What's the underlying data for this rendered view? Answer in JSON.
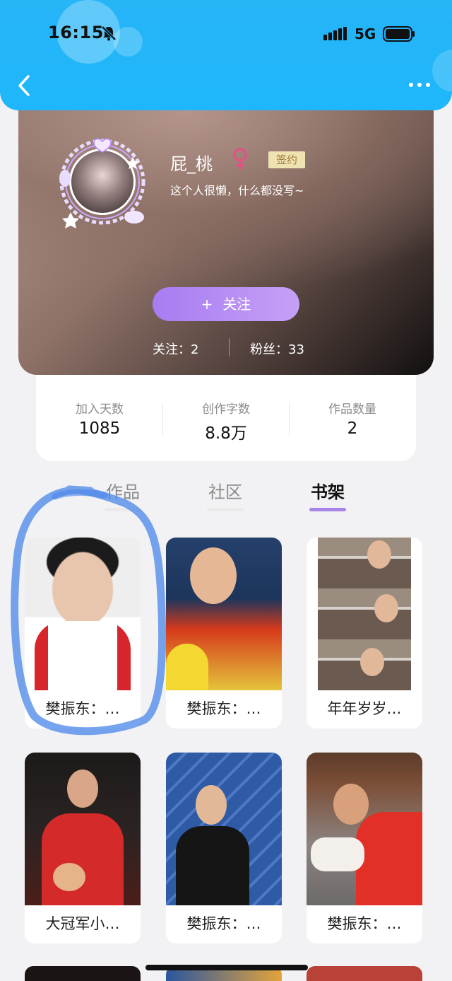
{
  "status_bar": {
    "time": "16:15",
    "network": "5G",
    "icons": [
      "mute-bell-icon",
      "signal-icon",
      "battery-icon"
    ]
  },
  "nav": {
    "back_icon": "chevron-left-icon",
    "more_icon": "more-dots-icon",
    "accent": "#26b5f7"
  },
  "profile": {
    "username": "屁_桃",
    "gender_icon": "female-icon",
    "gender_color": "#e64f86",
    "badge": "签约",
    "bio": "这个人很懒，什么都没写~",
    "follow_button": {
      "plus": "+",
      "label": "关注"
    },
    "following": "关注：2",
    "fans": "粉丝：33"
  },
  "stats": [
    {
      "label": "加入天数",
      "value": "1085"
    },
    {
      "label": "创作字数",
      "value": "8.8万"
    },
    {
      "label": "作品数量",
      "value": "2"
    }
  ],
  "tabs": [
    {
      "label": "作品",
      "active": false
    },
    {
      "label": "社区",
      "active": false
    },
    {
      "label": "书架",
      "active": true
    }
  ],
  "tab_accent": "#a985e8",
  "books": [
    {
      "title": "樊振东：…"
    },
    {
      "title": "樊振东：…"
    },
    {
      "title": "年年岁岁…"
    },
    {
      "title": "大冠军小…"
    },
    {
      "title": "樊振东：…"
    },
    {
      "title": "樊振东：…"
    }
  ],
  "annotation_color": "#4a86e8"
}
